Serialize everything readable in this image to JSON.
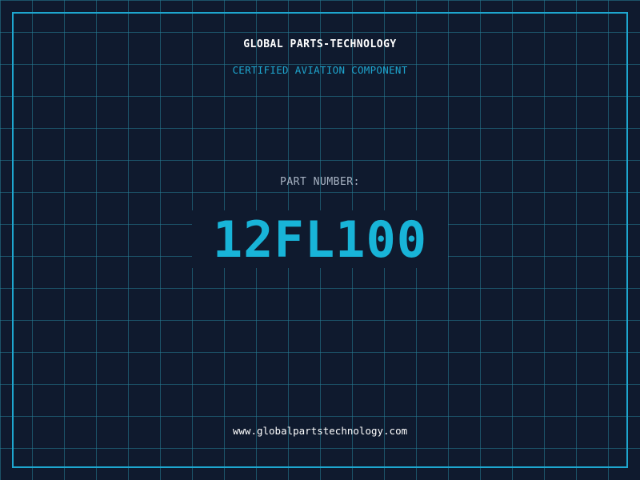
{
  "header": {
    "company": "GLOBAL PARTS-TECHNOLOGY",
    "subtitle": "CERTIFIED AVIATION COMPONENT"
  },
  "part": {
    "label": "PART NUMBER:",
    "number": "12FL100"
  },
  "footer": {
    "website": "www.globalpartstechnology.com"
  },
  "colors": {
    "background": "#0f1a2e",
    "accent": "#1ea6cf",
    "part_number": "#18b4d8",
    "label": "#a9b4c4",
    "text": "#ffffff"
  }
}
